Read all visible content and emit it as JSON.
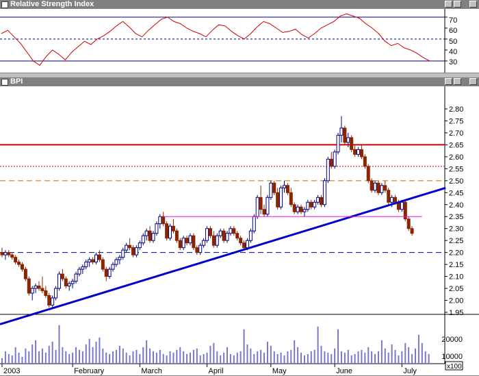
{
  "rsi_window": {
    "title": "Relative Strength Index",
    "axis_labels": [
      "70",
      "60",
      "50",
      "40",
      "30"
    ]
  },
  "main_window": {
    "title": "BPI",
    "price_labels": [
      "2.80",
      "2.75",
      "2.70",
      "2.65",
      "2.60",
      "2.55",
      "2.50",
      "2.45",
      "2.40",
      "2.35",
      "2.30",
      "2.25",
      "2.20",
      "2.15",
      "2.10",
      "2.05",
      "2.00",
      "1.95"
    ],
    "volume_labels": [
      "20000",
      "10000"
    ],
    "volume_unit": "x100",
    "date_labels": [
      "2003",
      "February",
      "March",
      "April",
      "May",
      "June",
      "July"
    ]
  },
  "colors": {
    "up_candle": "#ffffff",
    "up_outline": "#000080",
    "down_candle": "#8b2500",
    "resistance": "#d00000",
    "support_dashed": "#000080",
    "trendline": "#0000cc",
    "channel": "#ff00ff",
    "rsi_line": "#d00000",
    "volume": "#7777cc"
  },
  "chart_data": [
    {
      "type": "line",
      "title": "Relative Strength Index",
      "ylim": [
        20,
        75
      ],
      "reference_lines": [
        70,
        50,
        30
      ],
      "series": [
        {
          "values": [
            55,
            58,
            52,
            46,
            38,
            30,
            26,
            34,
            40,
            36,
            31,
            38,
            43,
            48,
            45,
            50,
            53,
            57,
            62,
            66,
            61,
            55,
            52,
            58,
            63,
            68,
            70,
            66,
            64,
            60,
            57,
            55,
            52,
            58,
            63,
            62,
            57,
            53,
            50,
            55,
            61,
            66,
            64,
            60,
            56,
            57,
            59,
            54,
            51,
            55,
            60,
            63,
            66,
            71,
            73,
            71,
            69,
            64,
            60,
            55,
            48,
            44,
            46,
            42,
            40,
            37,
            33,
            30
          ]
        }
      ]
    },
    {
      "type": "candlestick",
      "title": "BPI",
      "ylim": [
        1.9,
        2.84
      ],
      "x_labels": [
        "2003",
        "February",
        "March",
        "April",
        "May",
        "June",
        "July"
      ],
      "horizontal_lines": [
        {
          "y": 2.65,
          "style": "solid",
          "color": "#d00000"
        },
        {
          "y": 2.56,
          "style": "dotted",
          "color": "#d00000"
        },
        {
          "y": 2.5,
          "style": "dashed",
          "color": "#cc6600"
        },
        {
          "y": 2.2,
          "style": "dashed",
          "color": "#000080"
        }
      ],
      "trendline": {
        "from": [
          0,
          1.9
        ],
        "to": [
          132,
          2.47
        ]
      },
      "channel_line": {
        "y": 2.35,
        "from_index": 48,
        "to_index": 125
      },
      "ohlc": [
        [
          2.2,
          2.22,
          2.18,
          2.19
        ],
        [
          2.19,
          2.21,
          2.17,
          2.2
        ],
        [
          2.2,
          2.21,
          2.18,
          2.19
        ],
        [
          2.19,
          2.2,
          2.17,
          2.18
        ],
        [
          2.18,
          2.19,
          2.15,
          2.16
        ],
        [
          2.16,
          2.17,
          2.14,
          2.15
        ],
        [
          2.15,
          2.16,
          2.12,
          2.13
        ],
        [
          2.13,
          2.14,
          2.08,
          2.09
        ],
        [
          2.09,
          2.1,
          2.02,
          2.03
        ],
        [
          2.03,
          2.06,
          2.0,
          2.05
        ],
        [
          2.05,
          2.07,
          2.03,
          2.06
        ],
        [
          2.06,
          2.08,
          2.04,
          2.05
        ],
        [
          2.05,
          2.1,
          2.03,
          2.04
        ],
        [
          2.04,
          2.06,
          2.01,
          2.02
        ],
        [
          2.02,
          2.03,
          1.97,
          1.98
        ],
        [
          1.98,
          2.02,
          1.97,
          2.01
        ],
        [
          2.01,
          2.06,
          2.0,
          2.05
        ],
        [
          2.05,
          2.12,
          2.04,
          2.11
        ],
        [
          2.11,
          2.13,
          2.08,
          2.09
        ],
        [
          2.09,
          2.1,
          2.05,
          2.06
        ],
        [
          2.06,
          2.08,
          2.04,
          2.07
        ],
        [
          2.07,
          2.09,
          2.05,
          2.08
        ],
        [
          2.08,
          2.12,
          2.07,
          2.11
        ],
        [
          2.11,
          2.14,
          2.1,
          2.13
        ],
        [
          2.13,
          2.15,
          2.11,
          2.14
        ],
        [
          2.14,
          2.17,
          2.13,
          2.16
        ],
        [
          2.16,
          2.18,
          2.14,
          2.17
        ],
        [
          2.17,
          2.18,
          2.15,
          2.16
        ],
        [
          2.16,
          2.2,
          2.15,
          2.19
        ],
        [
          2.19,
          2.21,
          2.16,
          2.17
        ],
        [
          2.17,
          2.18,
          2.12,
          2.13
        ],
        [
          2.13,
          2.14,
          2.08,
          2.1
        ],
        [
          2.1,
          2.14,
          2.09,
          2.13
        ],
        [
          2.13,
          2.16,
          2.12,
          2.15
        ],
        [
          2.15,
          2.18,
          2.14,
          2.17
        ],
        [
          2.17,
          2.19,
          2.15,
          2.18
        ],
        [
          2.18,
          2.22,
          2.17,
          2.21
        ],
        [
          2.21,
          2.24,
          2.2,
          2.23
        ],
        [
          2.23,
          2.26,
          2.21,
          2.22
        ],
        [
          2.22,
          2.23,
          2.18,
          2.19
        ],
        [
          2.19,
          2.23,
          2.18,
          2.22
        ],
        [
          2.22,
          2.25,
          2.21,
          2.24
        ],
        [
          2.24,
          2.28,
          2.23,
          2.27
        ],
        [
          2.27,
          2.3,
          2.25,
          2.29
        ],
        [
          2.29,
          2.31,
          2.24,
          2.25
        ],
        [
          2.25,
          2.29,
          2.24,
          2.28
        ],
        [
          2.28,
          2.33,
          2.27,
          2.32
        ],
        [
          2.32,
          2.36,
          2.3,
          2.35
        ],
        [
          2.35,
          2.37,
          2.31,
          2.32
        ],
        [
          2.32,
          2.33,
          2.25,
          2.26
        ],
        [
          2.26,
          2.32,
          2.25,
          2.31
        ],
        [
          2.31,
          2.34,
          2.28,
          2.29
        ],
        [
          2.29,
          2.3,
          2.24,
          2.25
        ],
        [
          2.25,
          2.26,
          2.21,
          2.22
        ],
        [
          2.22,
          2.27,
          2.21,
          2.26
        ],
        [
          2.26,
          2.27,
          2.23,
          2.24
        ],
        [
          2.24,
          2.28,
          2.23,
          2.27
        ],
        [
          2.27,
          2.28,
          2.21,
          2.22
        ],
        [
          2.22,
          2.23,
          2.19,
          2.2
        ],
        [
          2.2,
          2.24,
          2.19,
          2.23
        ],
        [
          2.23,
          2.26,
          2.22,
          2.25
        ],
        [
          2.25,
          2.31,
          2.24,
          2.3
        ],
        [
          2.3,
          2.31,
          2.26,
          2.27
        ],
        [
          2.27,
          2.29,
          2.22,
          2.23
        ],
        [
          2.23,
          2.28,
          2.22,
          2.27
        ],
        [
          2.27,
          2.3,
          2.26,
          2.29
        ],
        [
          2.29,
          2.3,
          2.24,
          2.25
        ],
        [
          2.25,
          2.29,
          2.24,
          2.28
        ],
        [
          2.28,
          2.31,
          2.27,
          2.3
        ],
        [
          2.3,
          2.31,
          2.27,
          2.28
        ],
        [
          2.28,
          2.29,
          2.25,
          2.26
        ],
        [
          2.26,
          2.27,
          2.23,
          2.24
        ],
        [
          2.24,
          2.25,
          2.21,
          2.22
        ],
        [
          2.22,
          2.26,
          2.21,
          2.25
        ],
        [
          2.25,
          2.3,
          2.24,
          2.29
        ],
        [
          2.29,
          2.36,
          2.28,
          2.35
        ],
        [
          2.35,
          2.44,
          2.34,
          2.43
        ],
        [
          2.43,
          2.48,
          2.36,
          2.38
        ],
        [
          2.38,
          2.4,
          2.35,
          2.36
        ],
        [
          2.36,
          2.44,
          2.35,
          2.43
        ],
        [
          2.43,
          2.5,
          2.42,
          2.49
        ],
        [
          2.49,
          2.5,
          2.44,
          2.45
        ],
        [
          2.45,
          2.47,
          2.38,
          2.39
        ],
        [
          2.39,
          2.48,
          2.38,
          2.47
        ],
        [
          2.47,
          2.5,
          2.45,
          2.48
        ],
        [
          2.48,
          2.49,
          2.44,
          2.45
        ],
        [
          2.45,
          2.47,
          2.39,
          2.4
        ],
        [
          2.4,
          2.41,
          2.36,
          2.37
        ],
        [
          2.37,
          2.4,
          2.36,
          2.39
        ],
        [
          2.39,
          2.4,
          2.36,
          2.37
        ],
        [
          2.37,
          2.39,
          2.35,
          2.38
        ],
        [
          2.38,
          2.42,
          2.37,
          2.41
        ],
        [
          2.41,
          2.42,
          2.38,
          2.39
        ],
        [
          2.39,
          2.42,
          2.38,
          2.41
        ],
        [
          2.41,
          2.44,
          2.4,
          2.43
        ],
        [
          2.43,
          2.44,
          2.39,
          2.4
        ],
        [
          2.4,
          2.51,
          2.39,
          2.5
        ],
        [
          2.5,
          2.6,
          2.49,
          2.59
        ],
        [
          2.59,
          2.62,
          2.55,
          2.56
        ],
        [
          2.56,
          2.63,
          2.55,
          2.62
        ],
        [
          2.62,
          2.7,
          2.61,
          2.69
        ],
        [
          2.69,
          2.77,
          2.66,
          2.72
        ],
        [
          2.72,
          2.73,
          2.65,
          2.66
        ],
        [
          2.66,
          2.7,
          2.64,
          2.68
        ],
        [
          2.68,
          2.69,
          2.62,
          2.63
        ],
        [
          2.63,
          2.65,
          2.6,
          2.61
        ],
        [
          2.61,
          2.64,
          2.6,
          2.63
        ],
        [
          2.63,
          2.65,
          2.59,
          2.6
        ],
        [
          2.6,
          2.61,
          2.55,
          2.56
        ],
        [
          2.56,
          2.57,
          2.49,
          2.5
        ],
        [
          2.5,
          2.51,
          2.45,
          2.46
        ],
        [
          2.46,
          2.5,
          2.45,
          2.49
        ],
        [
          2.49,
          2.5,
          2.44,
          2.45
        ],
        [
          2.45,
          2.49,
          2.44,
          2.48
        ],
        [
          2.48,
          2.5,
          2.45,
          2.46
        ],
        [
          2.46,
          2.47,
          2.4,
          2.41
        ],
        [
          2.41,
          2.44,
          2.39,
          2.43
        ],
        [
          2.43,
          2.44,
          2.4,
          2.41
        ],
        [
          2.41,
          2.42,
          2.37,
          2.38
        ],
        [
          2.38,
          2.42,
          2.37,
          2.41
        ],
        [
          2.41,
          2.42,
          2.33,
          2.34
        ],
        [
          2.34,
          2.35,
          2.29,
          2.3
        ],
        [
          2.3,
          2.31,
          2.27,
          2.28
        ]
      ],
      "volume": [
        400,
        900,
        700,
        600,
        1200,
        800,
        500,
        1100,
        900,
        1400,
        1700,
        900,
        1100,
        800,
        1300,
        1600,
        1000,
        2800,
        1200,
        900,
        700,
        800,
        1200,
        1000,
        900,
        1400,
        1800,
        1200,
        1600,
        1900,
        1100,
        800,
        700,
        900,
        1000,
        1300,
        1100,
        800,
        600,
        900,
        1000,
        700,
        1200,
        1700,
        1100,
        900,
        800,
        1000,
        700,
        600,
        900,
        800,
        1000,
        1200,
        900,
        700,
        800,
        1000,
        1100,
        600,
        700,
        800,
        1300,
        1500,
        900,
        600,
        800,
        1200,
        700,
        600,
        800,
        900,
        2500,
        1400,
        1100,
        700,
        900,
        1000,
        800,
        1600,
        1300,
        900,
        700,
        800,
        600,
        900,
        1000,
        1700,
        1200,
        800,
        600,
        700,
        900,
        1000,
        2700,
        1300,
        900,
        800,
        700,
        1100,
        2500,
        900,
        800,
        1000,
        600,
        700,
        900,
        1000,
        800,
        1200,
        900,
        700,
        900,
        1700,
        1100,
        800,
        1400,
        1000,
        600,
        900,
        1500,
        1200,
        700,
        1100,
        2100,
        1500,
        900,
        700
      ]
    }
  ]
}
